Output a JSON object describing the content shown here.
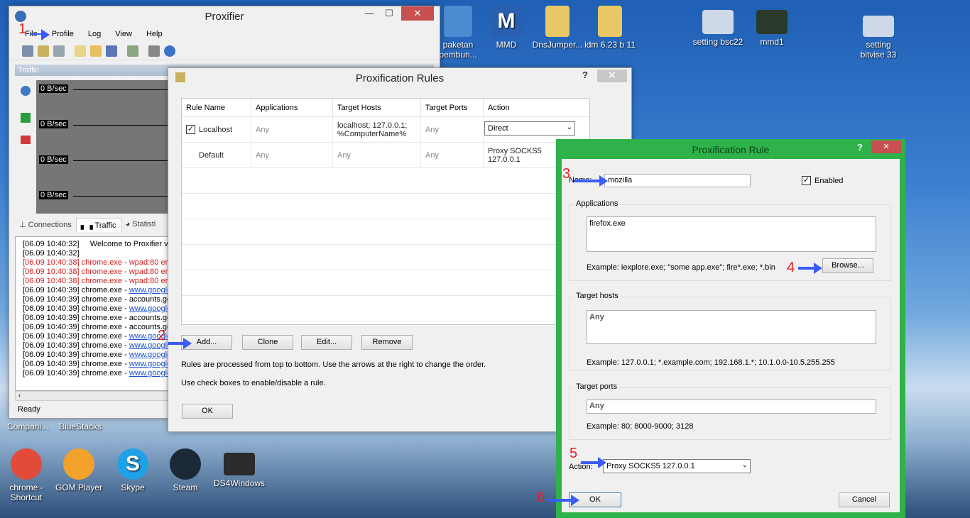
{
  "desktop": {
    "icons_top": [
      {
        "label": "paketan\npembun...",
        "color": "#4a8bd1"
      },
      {
        "label": "MMD",
        "color": "#2a5fb0"
      },
      {
        "label": "DnsJumper...",
        "color": "#e8c766"
      },
      {
        "label": "idm 6.23 b 11",
        "color": "#e8c766"
      },
      {
        "label": "setting bsc22",
        "color": "#cfd8e6"
      },
      {
        "label": "mmd1",
        "color": "#2b3a2b"
      },
      {
        "label": "setting\nbitvise 33",
        "color": "#cfd8e6"
      }
    ],
    "icons_bottom": [
      {
        "label": "chrome -\nShortcut",
        "color": "#e24b3a"
      },
      {
        "label": "GOM Player",
        "color": "#f2a22a"
      },
      {
        "label": "Skype",
        "color": "#1ea1e6"
      },
      {
        "label": "Steam",
        "color": "#1b2838"
      },
      {
        "label": "DS4Windows",
        "color": "#2b2b2b"
      }
    ],
    "icons_mid": [
      "Compani...",
      "BlueStacks"
    ]
  },
  "proxifier": {
    "title": "Proxifier",
    "menu": [
      "File",
      "Profile",
      "Log",
      "View",
      "Help"
    ],
    "traffic_label": "Traffic",
    "rates": [
      "0 B/sec",
      "0 B/sec",
      "0 B/sec",
      "0 B/sec"
    ],
    "tabs": [
      "Connections",
      "Traffic",
      "Statisti"
    ],
    "log": [
      {
        "t": "[06.09 10:40:32]",
        "msg": "     Welcome to Proxifier v3",
        "kind": "normal"
      },
      {
        "t": "[06.09 10:40:32]",
        "msg": "",
        "kind": "normal"
      },
      {
        "t": "[06.09 10:40:38]",
        "msg": " chrome.exe - wpad:80 erro",
        "kind": "red"
      },
      {
        "t": "[06.09 10:40:38]",
        "msg": " chrome.exe - wpad:80 erro",
        "kind": "red"
      },
      {
        "t": "[06.09 10:40:38]",
        "msg": " chrome.exe - wpad:80 erro",
        "kind": "red"
      },
      {
        "t": "[06.09 10:40:39]",
        "msg": " chrome.exe - ",
        "link": "www.google",
        "kind": "link"
      },
      {
        "t": "[06.09 10:40:39]",
        "msg": " chrome.exe - accounts.go",
        "kind": "normal"
      },
      {
        "t": "[06.09 10:40:39]",
        "msg": " chrome.exe - ",
        "link": "www.google",
        "kind": "link"
      },
      {
        "t": "[06.09 10:40:39]",
        "msg": " chrome.exe - accounts.go",
        "kind": "normal"
      },
      {
        "t": "[06.09 10:40:39]",
        "msg": " chrome.exe - accounts.go",
        "kind": "normal"
      },
      {
        "t": "[06.09 10:40:39]",
        "msg": " chrome.exe - ",
        "link": "www.google",
        "kind": "link"
      },
      {
        "t": "[06.09 10:40:39]",
        "msg": " chrome.exe - ",
        "link": "www.google",
        "kind": "link"
      },
      {
        "t": "[06.09 10:40:39]",
        "msg": " chrome.exe - ",
        "link": "www.google",
        "kind": "link"
      },
      {
        "t": "[06.09 10:40:39]",
        "msg": " chrome.exe - ",
        "link": "www.google",
        "kind": "link"
      },
      {
        "t": "[06.09 10:40:39]",
        "msg": " chrome.exe - ",
        "link": "www.google",
        "kind": "link"
      }
    ],
    "status": "Ready"
  },
  "rules_dialog": {
    "title": "Proxification Rules",
    "help": "?",
    "close": "✕",
    "columns": [
      "Rule Name",
      "Applications",
      "Target Hosts",
      "Target Ports",
      "Action"
    ],
    "rows": [
      {
        "checked": true,
        "name": "Localhost",
        "apps": "Any",
        "hosts": "localhost; 127.0.0.1;\n%ComputerName%",
        "ports": "Any",
        "action": "Direct",
        "action_is_select": true
      },
      {
        "checked": false,
        "name": "Default",
        "apps": "Any",
        "hosts": "Any",
        "ports": "Any",
        "action": "Proxy SOCKS5\n127.0.0.1",
        "action_is_select": false
      }
    ],
    "buttons": {
      "add": "Add...",
      "clone": "Clone",
      "edit": "Edit...",
      "remove": "Remove",
      "ok": "OK"
    },
    "hint1": "Rules are processed from top to bottom. Use the arrows at the right to change the order.",
    "hint2": "Use check boxes to enable/disable a rule."
  },
  "rule_dialog": {
    "title": "Proxification Rule",
    "help": "?",
    "close": "✕",
    "name_label": "Name:",
    "name_value": "mozilla",
    "enabled_label": "Enabled",
    "enabled": true,
    "applications_title": "Applications",
    "applications_value": "firefox.exe",
    "applications_example": "Example: iexplore.exe; \"some app.exe\"; fire*.exe; *.bin",
    "browse": "Browse...",
    "hosts_title": "Target hosts",
    "hosts_value": "Any",
    "hosts_example": "Example: 127.0.0.1; *.example.com; 192.168.1.*; 10.1.0.0-10.5.255.255",
    "ports_title": "Target ports",
    "ports_value": "Any",
    "ports_example": "Example: 80; 8000-9000; 3128",
    "action_label": "Action:",
    "action_value": "Proxy SOCKS5 127.0.0.1",
    "ok": "OK",
    "cancel": "Cancel"
  },
  "annotations": [
    "1",
    "2",
    "3",
    "4",
    "5",
    "6"
  ]
}
